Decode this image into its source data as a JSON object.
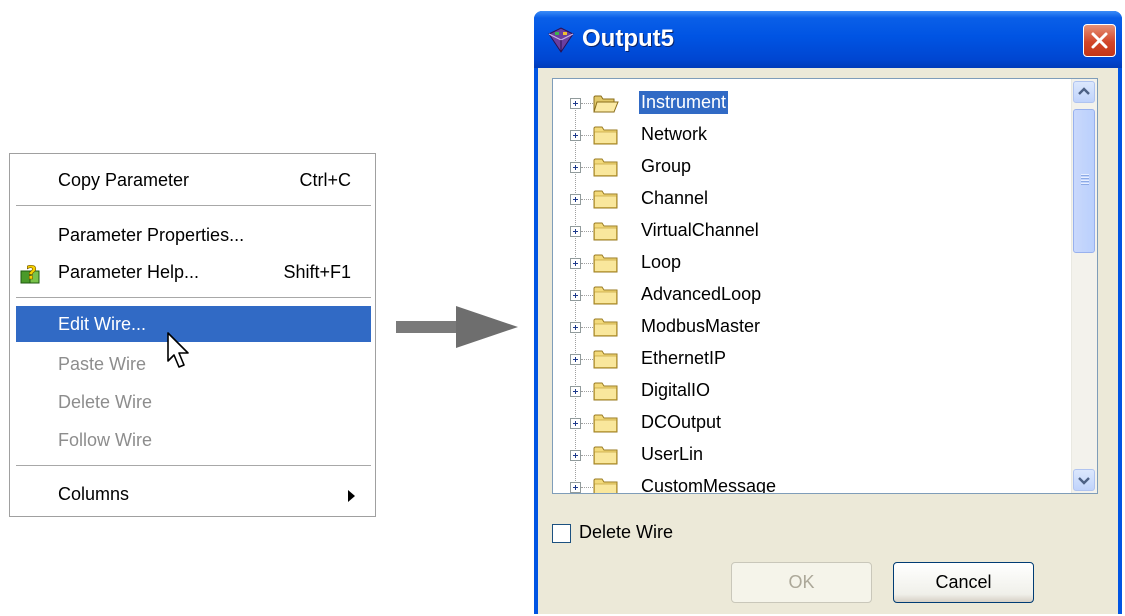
{
  "context_menu": {
    "items": [
      {
        "label": "Copy Parameter",
        "shortcut": "Ctrl+C",
        "state": "enabled"
      },
      {
        "label": "Parameter Properties...",
        "shortcut": "",
        "state": "enabled"
      },
      {
        "label": "Parameter Help...",
        "shortcut": "Shift+F1",
        "state": "enabled",
        "icon": "help-icon"
      },
      {
        "label": "Edit Wire...",
        "shortcut": "",
        "state": "highlighted"
      },
      {
        "label": "Paste Wire",
        "shortcut": "",
        "state": "disabled"
      },
      {
        "label": "Delete Wire",
        "shortcut": "",
        "state": "disabled"
      },
      {
        "label": "Follow Wire",
        "shortcut": "",
        "state": "disabled"
      },
      {
        "label": "Columns",
        "shortcut": "",
        "state": "enabled",
        "submenu": true
      }
    ]
  },
  "dialog": {
    "title": "Output5",
    "tree_items": [
      {
        "label": "Instrument",
        "selected": true
      },
      {
        "label": "Network"
      },
      {
        "label": "Group"
      },
      {
        "label": "Channel"
      },
      {
        "label": "VirtualChannel"
      },
      {
        "label": "Loop"
      },
      {
        "label": "AdvancedLoop"
      },
      {
        "label": "ModbusMaster"
      },
      {
        "label": "EthernetIP"
      },
      {
        "label": "DigitalIO"
      },
      {
        "label": "DCOutput"
      },
      {
        "label": "UserLin"
      },
      {
        "label": "CustomMessage"
      }
    ],
    "checkbox_label": "Delete Wire",
    "checkbox_checked": false,
    "ok_label": "OK",
    "cancel_label": "Cancel"
  },
  "colors": {
    "selection": "#316ac5",
    "titlebar": "#0054e3",
    "dialog_face": "#ece9d8",
    "disabled_text": "#8d8d8d"
  }
}
